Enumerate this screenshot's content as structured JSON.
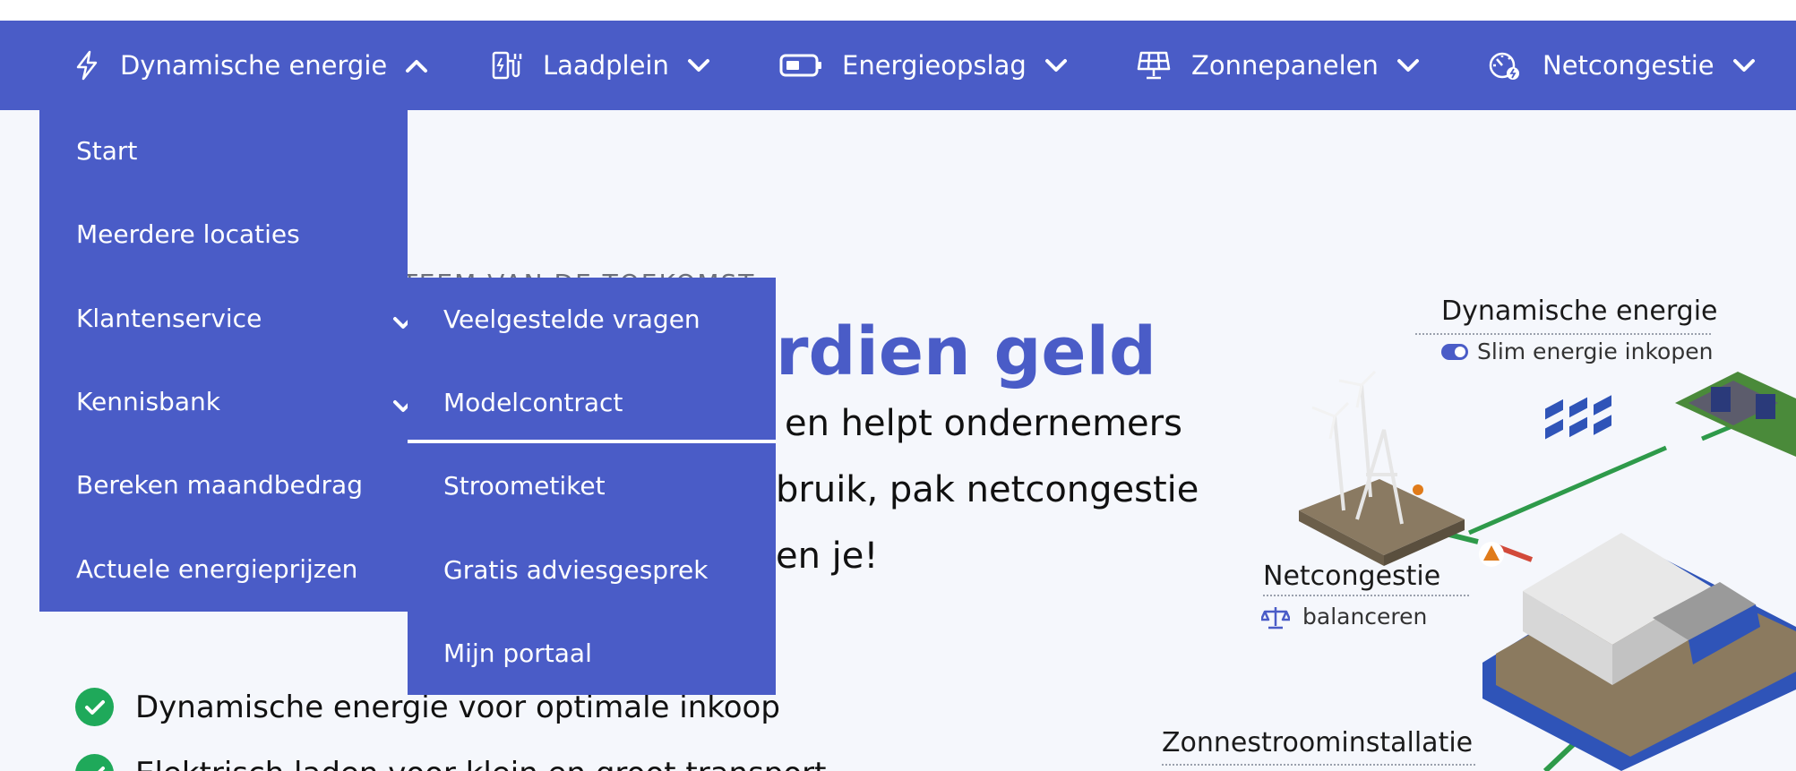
{
  "nav": {
    "items": [
      {
        "label": "Dynamische energie",
        "icon": "lightning-icon",
        "state": "expanded"
      },
      {
        "label": "Laadplein",
        "icon": "ev-charger-icon",
        "state": "collapsed"
      },
      {
        "label": "Energieopslag",
        "icon": "battery-icon",
        "state": "collapsed"
      },
      {
        "label": "Zonnepanelen",
        "icon": "solar-panel-icon",
        "state": "collapsed"
      },
      {
        "label": "Netcongestie",
        "icon": "grid-meter-icon",
        "state": "collapsed"
      }
    ]
  },
  "dropdown": {
    "items": [
      {
        "label": "Start"
      },
      {
        "label": "Meerdere locaties"
      },
      {
        "label": "Klantenservice",
        "has_submenu": true
      },
      {
        "label": "Kennisbank",
        "has_submenu": true
      },
      {
        "label": "Bereken maandbedrag"
      },
      {
        "label": "Actuele energieprijzen"
      }
    ]
  },
  "submenu": {
    "items": [
      {
        "label": "Veelgestelde vragen"
      },
      {
        "label": "Modelcontract"
      },
      {
        "label": "Stroometiket"
      },
      {
        "label": "Gratis adviesgesprek"
      },
      {
        "label": "Mijn portaal"
      }
    ]
  },
  "hero": {
    "eyebrow_visible": "IESYSTEEM VAN DE TOEKOMST",
    "headline_visible": "rdien geld",
    "body_lines": [
      "en helpt ondernemers",
      "bruik, pak netcongestie",
      "en je!"
    ],
    "bullets": [
      "Dynamische energie voor optimale inkoop",
      "Elektrisch laden voor klein en groot transport"
    ]
  },
  "illustration": {
    "labels": {
      "dynamic": "Dynamische energie",
      "dynamic_sub": "Slim energie inkopen",
      "congestion": "Netcongestie",
      "congestion_sub": "balanceren",
      "solar": "Zonnestroominstallatie"
    }
  },
  "colors": {
    "brand": "#4a5cc7",
    "check": "#1fa95a",
    "warning": "#e07b1a"
  }
}
